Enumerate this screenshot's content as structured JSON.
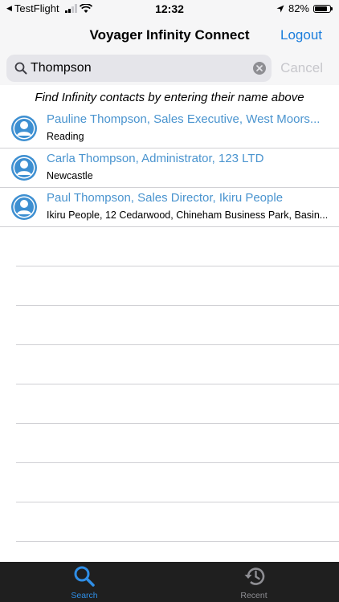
{
  "status": {
    "back_app": "TestFlight",
    "time": "12:32",
    "battery": "82%",
    "battery_level": 0.82
  },
  "nav": {
    "title": "Voyager Infinity Connect",
    "logout_label": "Logout"
  },
  "search": {
    "value": "Thompson",
    "cancel_label": "Cancel"
  },
  "hint": "Find Infinity contacts by entering their name above",
  "contacts": [
    {
      "title": "Pauline Thompson, Sales Executive, West Moors...",
      "subtitle": "Reading"
    },
    {
      "title": "Carla Thompson, Administrator, 123 LTD",
      "subtitle": "Newcastle"
    },
    {
      "title": "Paul Thompson, Sales Director, Ikiru People",
      "subtitle": "Ikiru People, 12 Cedarwood, Chineham Business Park, Basin..."
    }
  ],
  "tabs": [
    {
      "label": "Search",
      "icon": "search-icon",
      "active": true
    },
    {
      "label": "Recent",
      "icon": "history-icon",
      "active": false
    }
  ],
  "colors": {
    "accent": "#1a7ddc",
    "contact_title": "#4a94cf",
    "avatar": "#3d8fd1",
    "tab_active": "#2f8ee6",
    "tab_inactive": "#8e8e93",
    "tab_bar_bg": "#1f1f1f"
  }
}
